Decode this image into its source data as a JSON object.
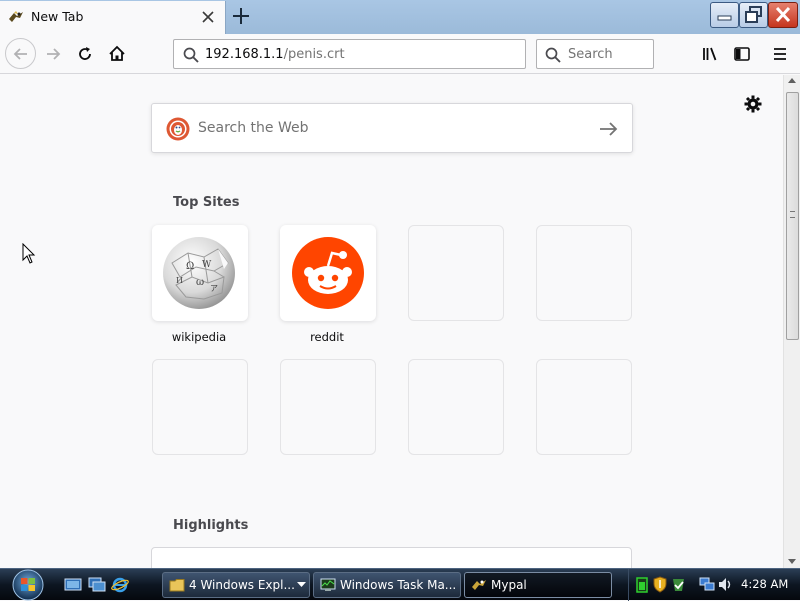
{
  "tab": {
    "title": "New Tab",
    "favicon": "mypal-icon",
    "close": "close-icon"
  },
  "toolbar": {
    "url_host": "192.168.1.1",
    "url_path": "/penis.crt",
    "search_placeholder": "Search"
  },
  "newtab": {
    "search_placeholder": "Search the Web",
    "top_sites_title": "Top Sites",
    "highlights_title": "Highlights",
    "top_sites": [
      {
        "label": "wikipedia",
        "icon": "wikipedia-globe-icon"
      },
      {
        "label": "reddit",
        "icon": "reddit-alien-icon"
      }
    ]
  },
  "taskbar": {
    "tasks": [
      {
        "label": "4 Windows Expl...",
        "icon": "folder-icon"
      },
      {
        "label": "Windows Task Ma...",
        "icon": "task-manager-icon"
      },
      {
        "label": "Mypal",
        "icon": "mypal-icon"
      }
    ],
    "clock": "4:28 AM"
  },
  "colors": {
    "accent": "#0a84ff",
    "reddit": "#ff4500",
    "duckduckgo": "#de5833",
    "tab_strip": "#a9c6e4",
    "close_button": "#c5351e"
  }
}
